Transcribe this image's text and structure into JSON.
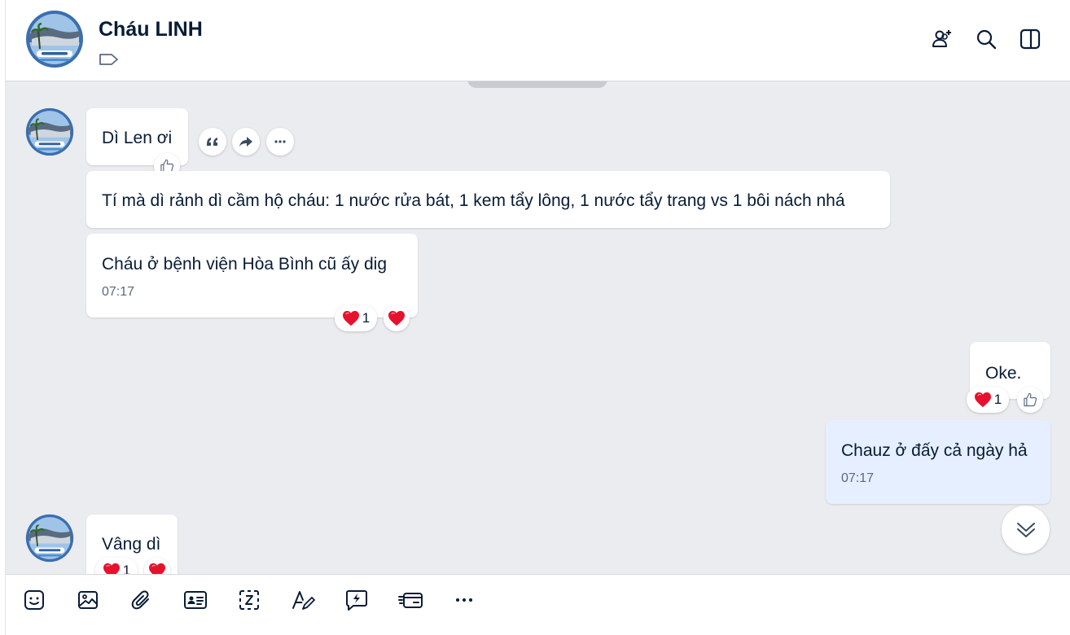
{
  "header": {
    "title": "Cháu LINH",
    "avatar_text": "CHÁU LINH",
    "icons": [
      "add-member-icon",
      "search-icon",
      "sidebar-toggle-icon"
    ]
  },
  "messages": [
    {
      "sender": "other",
      "text": "Dì Len ơi",
      "actions": [
        "quote-icon",
        "forward-icon",
        "more-icon"
      ],
      "reaction_button": "thumbs-up-icon"
    },
    {
      "sender": "other",
      "text": "Tí mà dì rảnh dì cầm hộ cháu: 1 nước rửa bát, 1 kem tẩy lông, 1 nước tẩy trang vs 1 bôi nách nhá"
    },
    {
      "sender": "other",
      "text": "Cháu ở bệnh viện Hòa Bình cũ ấy dig",
      "time": "07:17",
      "reaction_count": "1"
    },
    {
      "sender": "me",
      "text": "Oke.",
      "reaction_count": "1"
    },
    {
      "sender": "me",
      "text": "Chauz ở đấy cả ngày hả",
      "time": "07:17"
    },
    {
      "sender": "other",
      "text": "Vâng dì",
      "reaction_count": "1"
    }
  ],
  "toolbar": {
    "icons": [
      "sticker-icon",
      "image-icon",
      "attachment-icon",
      "contact-card-icon",
      "screenshot-icon",
      "text-format-icon",
      "quick-message-icon",
      "payment-card-icon",
      "more-icon"
    ]
  },
  "colors": {
    "chat_bg": "#ebecf0",
    "my_bubble": "#e5efff",
    "other_bubble": "#ffffff",
    "heart": "#e8112d"
  }
}
